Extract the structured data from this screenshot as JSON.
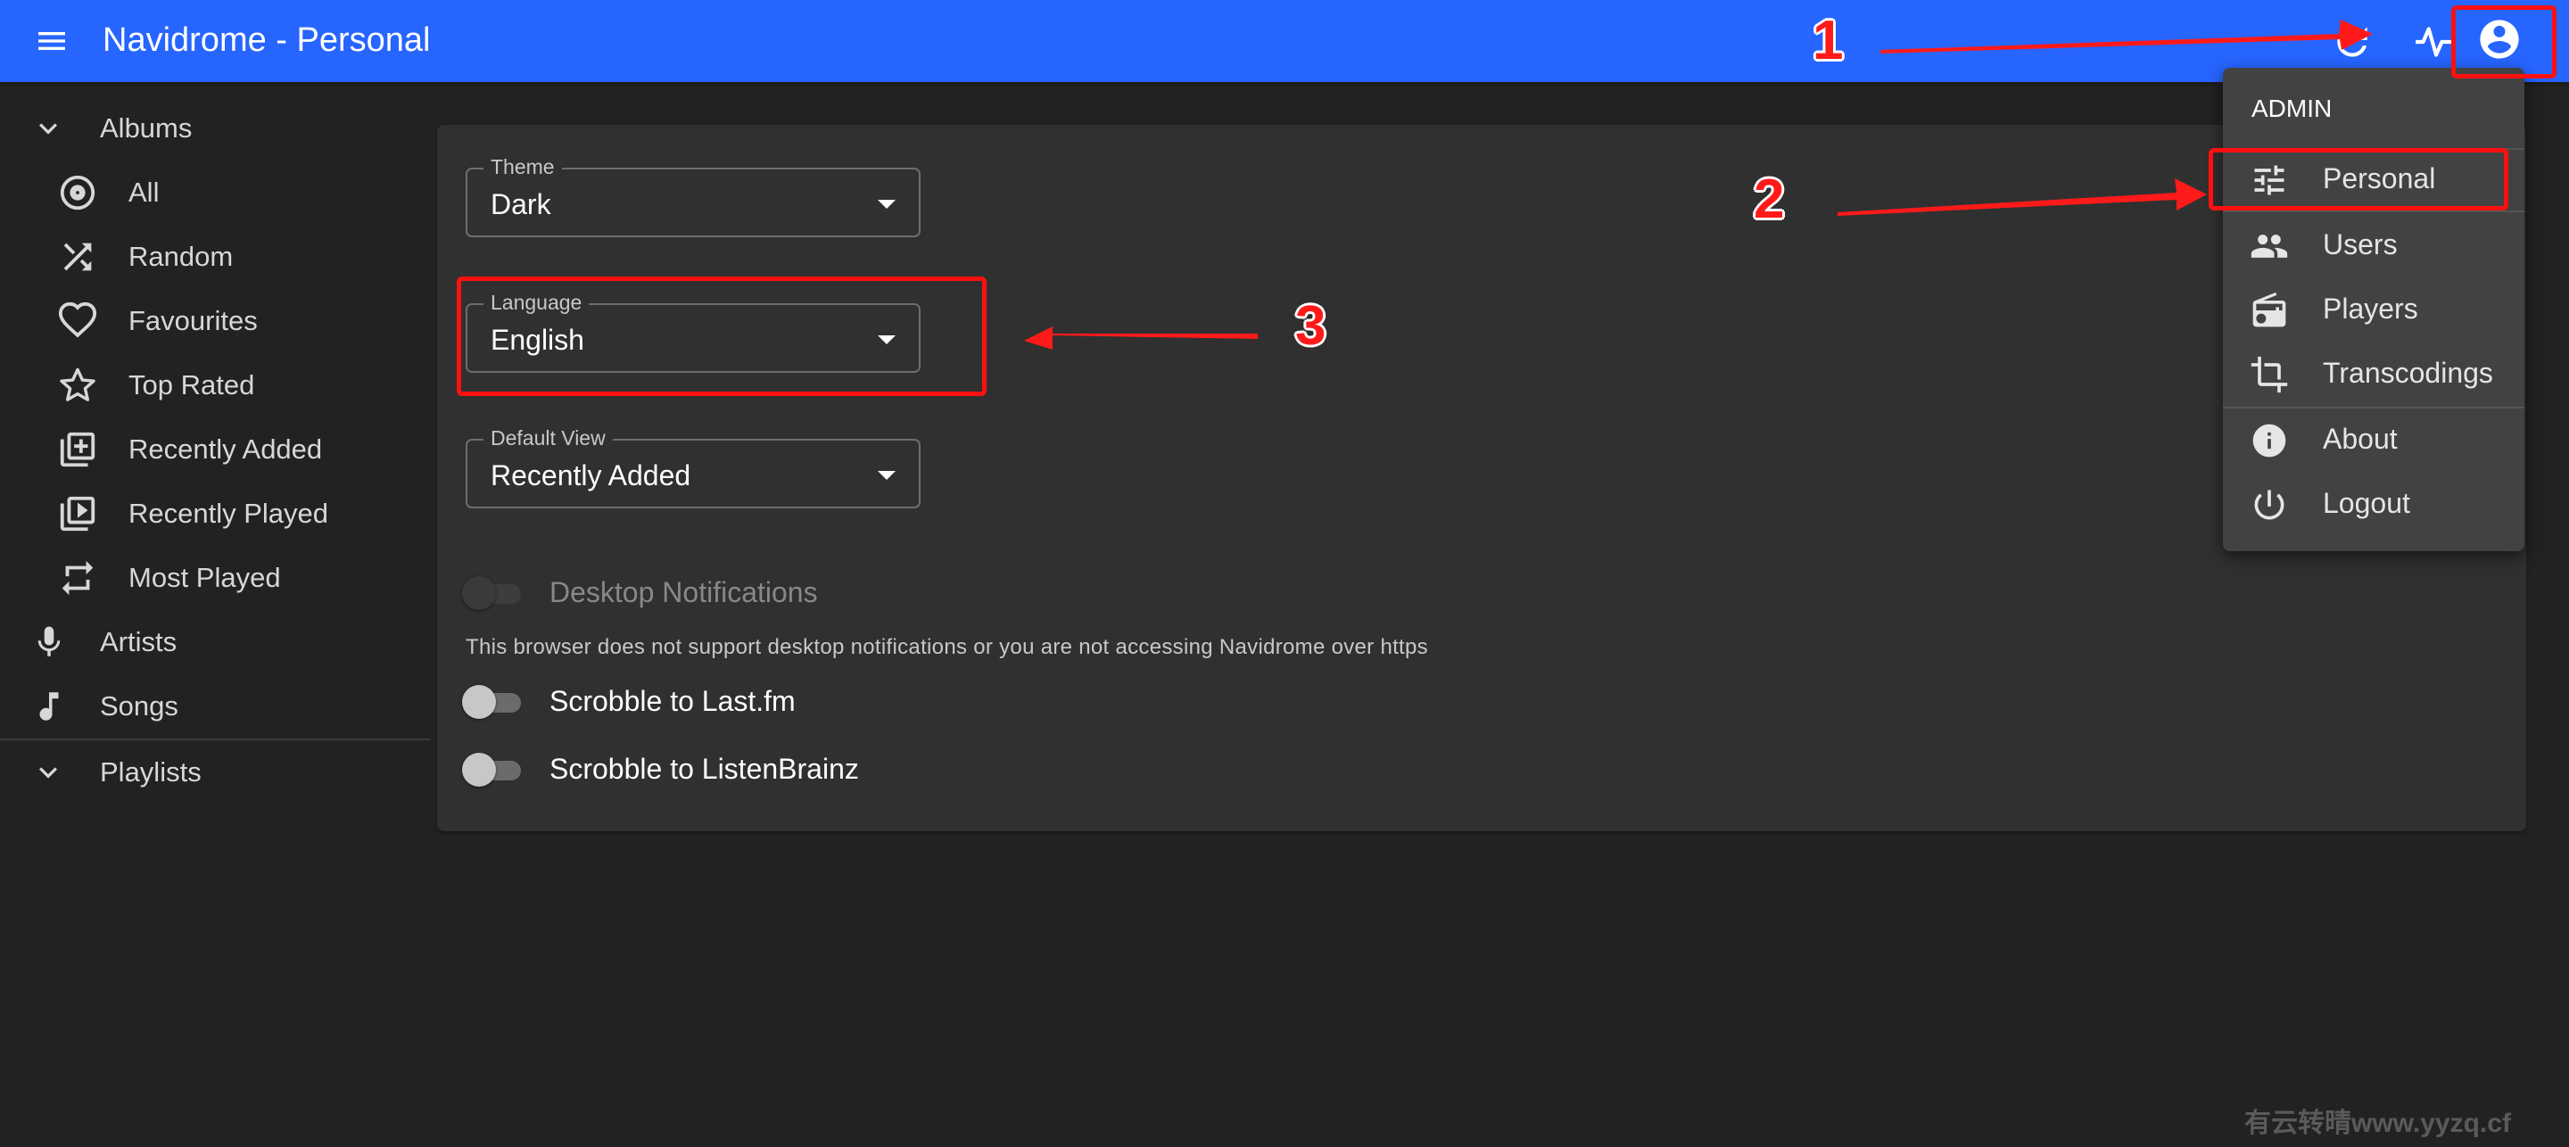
{
  "appbar": {
    "title": "Navidrome - Personal"
  },
  "sidebar": {
    "albums": {
      "label": "Albums",
      "items": [
        {
          "label": "All",
          "icon": "disc-icon"
        },
        {
          "label": "Random",
          "icon": "shuffle-icon"
        },
        {
          "label": "Favourites",
          "icon": "heart-icon"
        },
        {
          "label": "Top Rated",
          "icon": "star-icon"
        },
        {
          "label": "Recently Added",
          "icon": "library-add-icon"
        },
        {
          "label": "Recently Played",
          "icon": "video-library-icon"
        },
        {
          "label": "Most Played",
          "icon": "repeat-icon"
        }
      ]
    },
    "artists_label": "Artists",
    "songs_label": "Songs",
    "playlists_label": "Playlists"
  },
  "settings": {
    "theme": {
      "label": "Theme",
      "value": "Dark"
    },
    "language": {
      "label": "Language",
      "value": "English"
    },
    "default_view": {
      "label": "Default View",
      "value": "Recently Added"
    },
    "desktop_notifications": {
      "label": "Desktop Notifications",
      "enabled": false,
      "disabled": true
    },
    "helper_text": "This browser does not support desktop notifications or you are not accessing Navidrome over https",
    "scrobble_lastfm": {
      "label": "Scrobble to Last.fm",
      "enabled": false
    },
    "scrobble_listenbrainz": {
      "label": "Scrobble to ListenBrainz",
      "enabled": false
    }
  },
  "user_menu": {
    "heading": "ADMIN",
    "items": [
      {
        "label": "Personal",
        "icon": "tune-icon"
      },
      {
        "label": "Users",
        "icon": "people-icon"
      },
      {
        "label": "Players",
        "icon": "radio-icon"
      },
      {
        "label": "Transcodings",
        "icon": "crop-icon"
      },
      {
        "label": "About",
        "icon": "info-icon"
      },
      {
        "label": "Logout",
        "icon": "power-icon"
      }
    ]
  },
  "annotations": {
    "step1": "1",
    "step2": "2",
    "step3": "3"
  },
  "watermark": "有云转晴www.yyzq.cf",
  "colors": {
    "appbar": "#2765ff",
    "background": "#222222",
    "card": "#303030",
    "menu": "#424242",
    "annotation": "#ff1010"
  }
}
